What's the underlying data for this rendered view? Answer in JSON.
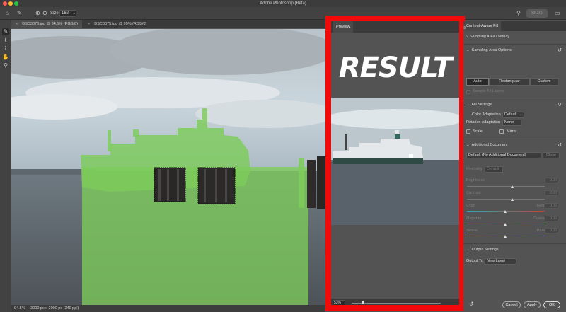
{
  "window": {
    "title": "Adobe Photoshop (Beta)"
  },
  "options_bar": {
    "size_label": "Size",
    "size_value": "162",
    "share_label": "Share"
  },
  "tabs": [
    {
      "label": "_DSC3076.jpg @ 94.5% (RGB/8)"
    },
    {
      "label": "_DSC3075.jpg @ 95% (RGB/8)"
    }
  ],
  "status": {
    "zoom": "94.5%",
    "info": "3000 px x 2000 px (240 ppi)"
  },
  "preview": {
    "tab_label": "Preview",
    "overlay_text": "RESULT",
    "zoom": "53%"
  },
  "panel": {
    "title": "Content-Aware Fill",
    "sampling_overlay": "Sampling Area Overlay",
    "sampling_options": "Sampling Area Options",
    "segments": [
      "Auto",
      "Rectangular",
      "Custom"
    ],
    "sample_all_layers": "Sample All Layers",
    "fill_settings": "Fill Settings",
    "color_adaptation_label": "Color Adaptation",
    "color_adaptation_value": "Default",
    "rotation_adaptation_label": "Rotation Adaptation",
    "rotation_adaptation_value": "None",
    "scale_label": "Scale",
    "mirror_label": "Mirror",
    "additional_document": "Additional Document",
    "additional_doc_value": "Default (No Additional Document)",
    "close_label": "Close",
    "flexibility_label": "Flexibility",
    "flexibility_value": "Default",
    "brightness_label": "Brightness",
    "brightness_value": "0.00",
    "contrast_label": "Contrast",
    "contrast_value": "0.00",
    "cyan_label": "Cyan",
    "red_label": "Red",
    "cyan_value": "0.00",
    "magenta_label": "Magenta",
    "green_label": "Green",
    "magenta_value": "0.00",
    "yellow_label": "Yellow",
    "blue_label": "Blue",
    "yellow_value": "0.00",
    "output_settings": "Output Settings",
    "output_to_label": "Output To",
    "output_to_value": "New Layer",
    "cancel_label": "Cancel",
    "apply_label": "Apply",
    "ok_label": "OK"
  },
  "colors": {
    "highlight_frame": "#f20a0a",
    "overlay_green": "#7ccc5a"
  }
}
